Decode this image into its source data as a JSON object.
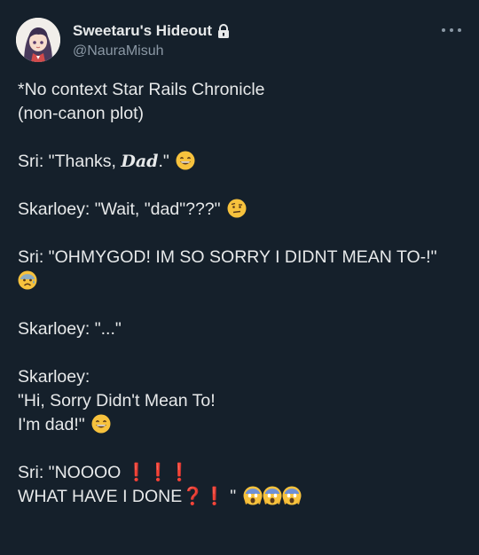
{
  "author": {
    "display_name": "Sweetaru's Hideout",
    "handle": "@NauraMisuh"
  },
  "icons": {
    "avatar": "anime-girl-avatar",
    "lock": "lock-icon",
    "more": "more-options-icon",
    "grin": "grinning-face-emoji",
    "raised_eyebrow": "raised-eyebrow-emoji",
    "anxious": "anxious-sweat-emoji",
    "scream": "screaming-face-emoji"
  },
  "colors": {
    "background": "#15202b",
    "text": "#e7e9ea",
    "muted": "#8b98a5",
    "exclaim": "#e0252d"
  },
  "post": {
    "l1": "*No context Star Rails Chronicle",
    "l2": "(non-canon plot)",
    "l3_pre": "Sri: \"Thanks, ",
    "l3_dad": "Dad",
    "l3_post": ".\"",
    "l4": "Skarloey: \"Wait, \"dad\"???\"",
    "l5": "Sri: \"OHMYGOD! IM SO SORRY I DIDNT MEAN TO-!\"",
    "l6": "Skarloey: \"...\"",
    "l7": "Skarloey:",
    "l8": "\"Hi, Sorry Didn't Mean To!",
    "l9": "I'm dad!\"",
    "l10": "Sri: \"NOOOO",
    "l10_marks": "❗❗❗",
    "l11": "WHAT HAVE I DONE",
    "l11_marks": "❓❗",
    "l11_quote": "\""
  }
}
